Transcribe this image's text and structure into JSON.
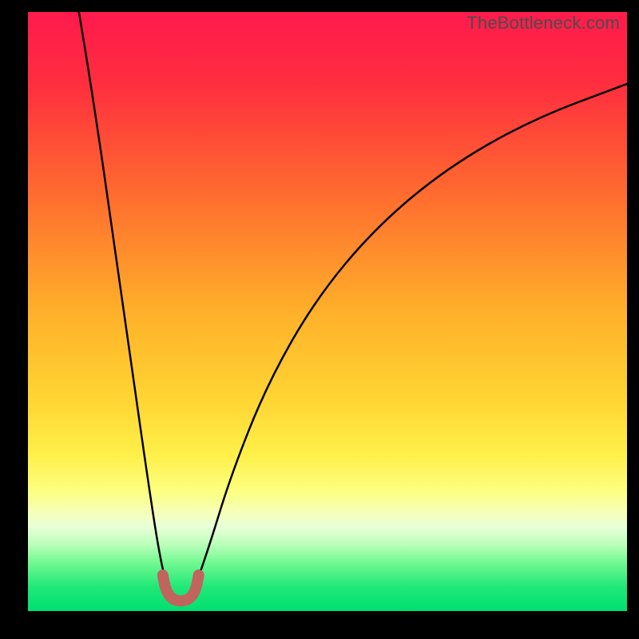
{
  "watermark": "TheBottleneck.com",
  "colors": {
    "background": "#000000",
    "curve": "#000000",
    "dip_marker": "#c1645e",
    "gradient_stops": [
      {
        "offset": 0.0,
        "color": "#ff1a4d"
      },
      {
        "offset": 0.12,
        "color": "#ff2e3f"
      },
      {
        "offset": 0.3,
        "color": "#ff6a2f"
      },
      {
        "offset": 0.5,
        "color": "#ffb02a"
      },
      {
        "offset": 0.65,
        "color": "#ffd633"
      },
      {
        "offset": 0.74,
        "color": "#fff04a"
      },
      {
        "offset": 0.8,
        "color": "#fcff80"
      },
      {
        "offset": 0.835,
        "color": "#f6ffb8"
      },
      {
        "offset": 0.86,
        "color": "#e8ffd8"
      },
      {
        "offset": 0.89,
        "color": "#b8ffb8"
      },
      {
        "offset": 0.92,
        "color": "#70f890"
      },
      {
        "offset": 0.96,
        "color": "#20e878"
      },
      {
        "offset": 1.0,
        "color": "#00e070"
      }
    ]
  },
  "chart_data": {
    "type": "line",
    "title": "",
    "xlabel": "",
    "ylabel": "",
    "x_range": [
      0,
      100
    ],
    "y_range": [
      0,
      100
    ],
    "legend": false,
    "grid": false,
    "note": "Bottleneck-style V-curve; two branches meeting at a minimum. Values are percent-of-plot coordinates (0,0 = bottom-left).",
    "series": [
      {
        "name": "left-branch",
        "x": [
          8.5,
          10,
          12,
          14,
          16,
          18,
          20,
          22,
          23.5
        ],
        "y": [
          100,
          91,
          78,
          64,
          50,
          36,
          22,
          9,
          3
        ]
      },
      {
        "name": "right-branch",
        "x": [
          27.5,
          30,
          34,
          40,
          48,
          58,
          70,
          84,
          100
        ],
        "y": [
          3,
          10,
          23,
          38,
          52,
          64,
          74,
          82,
          88
        ]
      },
      {
        "name": "dip-marker",
        "x": [
          22.5,
          23,
          24,
          25.5,
          27,
          28,
          28.5
        ],
        "y": [
          6,
          3.5,
          2,
          1.6,
          2,
          3.5,
          6
        ]
      }
    ],
    "minimum": {
      "x": 25.5,
      "y": 1.6
    }
  }
}
